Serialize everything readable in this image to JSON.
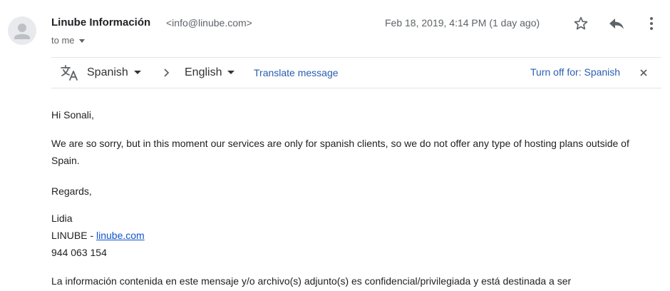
{
  "header": {
    "sender_name": "Linube Información",
    "sender_email": "<info@linube.com>",
    "to_label": "to me",
    "date": "Feb 18, 2019, 4:14 PM (1 day ago)",
    "icons": [
      "avatar-icon",
      "star-icon",
      "reply-icon",
      "more-vert-icon"
    ]
  },
  "translate_bar": {
    "from_language": "Spanish",
    "to_language": "English",
    "translate_link": "Translate message",
    "turn_off": "Turn off for: Spanish",
    "icons": [
      "translate-icon",
      "chevron-right-icon",
      "close-icon"
    ],
    "link_color": "#2a5db0"
  },
  "message": {
    "greeting": "Hi Sonali,",
    "paragraph": "We are so sorry, but in this moment our services are only for spanish clients, so we do not offer any type of hosting plans outside of Spain.",
    "regards": "Regards,",
    "signature": {
      "name": "Lidia",
      "company_prefix": "LINUBE - ",
      "company_link": "linube.com",
      "phone": "944 063 154"
    },
    "disclaimer": "La información contenida en este mensaje y/o archivo(s) adjunto(s) es confidencial/privilegiada y está destinada a ser"
  }
}
